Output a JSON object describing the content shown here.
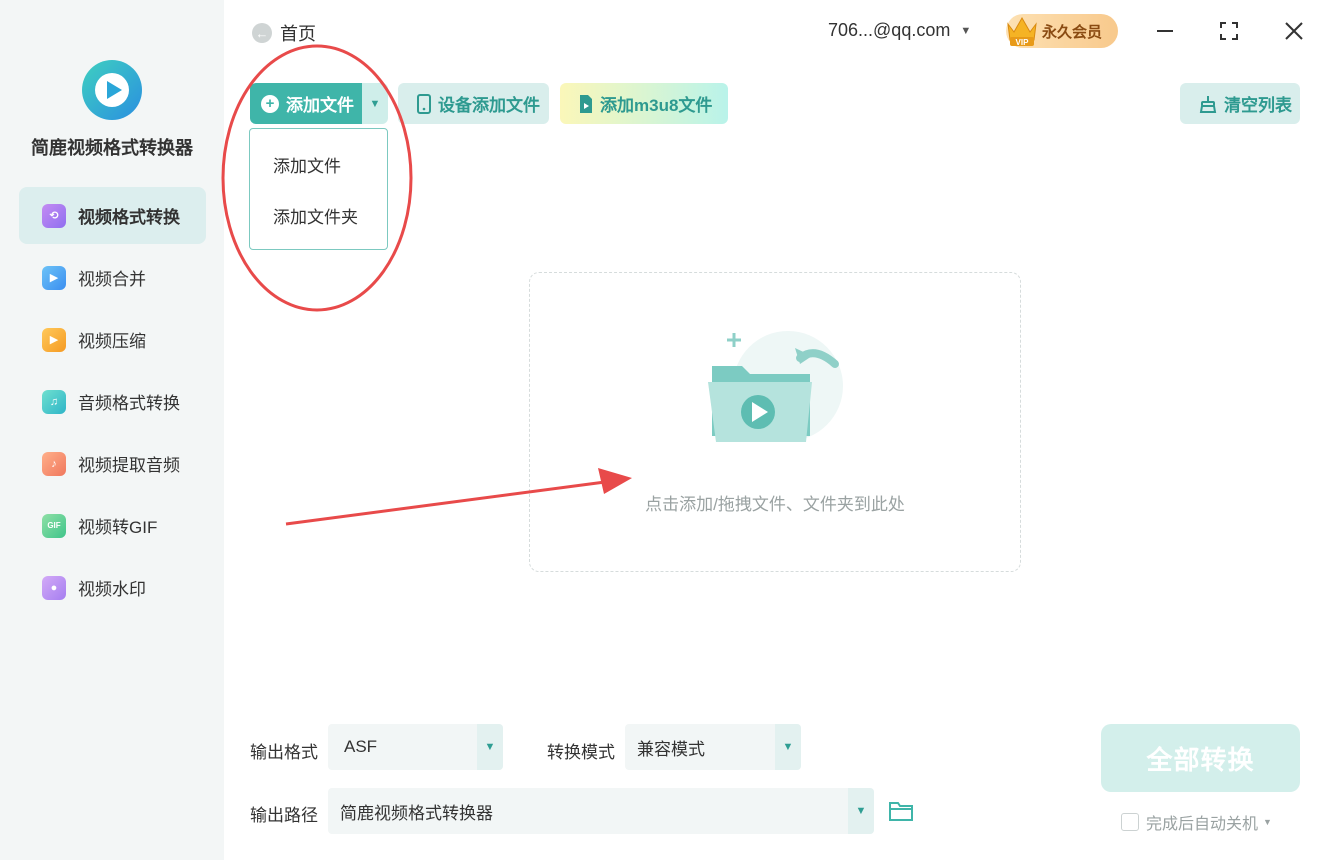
{
  "app": {
    "name": "简鹿视频格式转换器"
  },
  "sidebar": {
    "items": [
      {
        "label": "视频格式转换",
        "icon": "video-convert-icon",
        "color": "#b57ae8"
      },
      {
        "label": "视频合并",
        "icon": "video-merge-icon",
        "color": "#4aa8f0"
      },
      {
        "label": "视频压缩",
        "icon": "video-compress-icon",
        "color": "#f5a623"
      },
      {
        "label": "音频格式转换",
        "icon": "audio-convert-icon",
        "color": "#3cc6b6"
      },
      {
        "label": "视频提取音频",
        "icon": "extract-audio-icon",
        "color": "#f08a5d"
      },
      {
        "label": "视频转GIF",
        "icon": "gif-icon",
        "color": "#5dc98a"
      },
      {
        "label": "视频水印",
        "icon": "watermark-icon",
        "color": "#b78af0"
      }
    ]
  },
  "header": {
    "home_label": "首页",
    "account": "706...@qq.com",
    "vip_label": "永久会员"
  },
  "toolbar": {
    "add_file_label": "添加文件",
    "device_add_label": "设备添加文件",
    "add_m3u8_label": "添加m3u8文件",
    "clear_list_label": "清空列表"
  },
  "dropdown": {
    "items": [
      "添加文件",
      "添加文件夹"
    ]
  },
  "dropzone": {
    "hint": "点击添加/拖拽文件、文件夹到此处"
  },
  "footer": {
    "output_format_label": "输出格式",
    "output_format_value": "ASF",
    "convert_mode_label": "转换模式",
    "convert_mode_value": "兼容模式",
    "output_path_label": "输出路径",
    "output_path_value": "简鹿视频格式转换器",
    "convert_all_label": "全部转换",
    "shutdown_label": "完成后自动关机"
  },
  "colors": {
    "accent": "#3fb5a9",
    "annotation": "#e84a4a"
  }
}
